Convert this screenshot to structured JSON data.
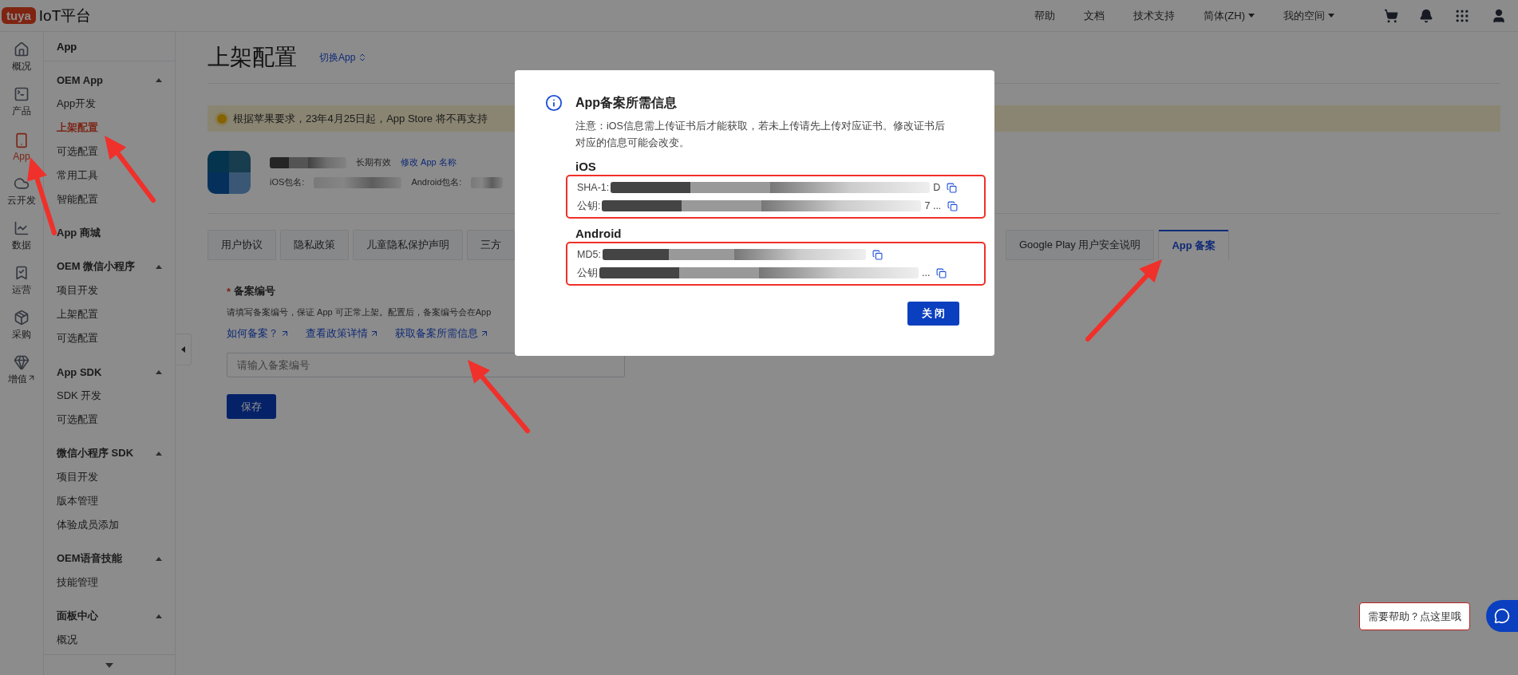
{
  "header": {
    "logo": "tuya",
    "title": "IoT平台",
    "links": [
      {
        "label": "帮助",
        "dropdown": false
      },
      {
        "label": "文档",
        "dropdown": false
      },
      {
        "label": "技术支持",
        "dropdown": false
      },
      {
        "label": "简体(ZH)",
        "dropdown": true
      },
      {
        "label": "我的空间",
        "dropdown": true
      }
    ]
  },
  "rail": [
    {
      "label": "概况",
      "selected": false,
      "external": false
    },
    {
      "label": "产品",
      "selected": false,
      "external": false
    },
    {
      "label": "App",
      "selected": true,
      "external": false
    },
    {
      "label": "云开发",
      "selected": false,
      "external": false
    },
    {
      "label": "数据",
      "selected": false,
      "external": false
    },
    {
      "label": "运营",
      "selected": false,
      "external": false
    },
    {
      "label": "采购",
      "selected": false,
      "external": false
    },
    {
      "label": "增值",
      "selected": false,
      "external": true
    }
  ],
  "sidebar": {
    "heading": "App",
    "groups": [
      {
        "kind": "group",
        "title": "OEM App",
        "expanded": true,
        "items": [
          {
            "label": "App开发",
            "selected": false
          },
          {
            "label": "上架配置",
            "selected": true
          },
          {
            "label": "可选配置",
            "selected": false
          },
          {
            "label": "常用工具",
            "selected": false
          },
          {
            "label": "智能配置",
            "selected": false
          }
        ]
      },
      {
        "kind": "link",
        "title": "App 商城"
      },
      {
        "kind": "group",
        "title": "OEM 微信小程序",
        "expanded": true,
        "items": [
          {
            "label": "项目开发",
            "selected": false
          },
          {
            "label": "上架配置",
            "selected": false
          },
          {
            "label": "可选配置",
            "selected": false
          }
        ]
      },
      {
        "kind": "group",
        "title": "App SDK",
        "expanded": true,
        "items": [
          {
            "label": "SDK 开发",
            "selected": false
          },
          {
            "label": "可选配置",
            "selected": false
          }
        ]
      },
      {
        "kind": "group",
        "title": "微信小程序 SDK",
        "expanded": true,
        "items": [
          {
            "label": "项目开发",
            "selected": false
          },
          {
            "label": "版本管理",
            "selected": false
          },
          {
            "label": "体验成员添加",
            "selected": false
          }
        ]
      },
      {
        "kind": "group",
        "title": "OEM语音技能",
        "expanded": true,
        "items": [
          {
            "label": "技能管理",
            "selected": false
          }
        ]
      },
      {
        "kind": "group",
        "title": "面板中心",
        "expanded": true,
        "items": [
          {
            "label": "概况",
            "selected": false
          }
        ]
      }
    ]
  },
  "page": {
    "title": "上架配置",
    "switch_link": "切换App",
    "notice": "根据苹果要求，23年4月25日起，App Store 将不再支持",
    "app": {
      "validity": "长期有效",
      "rename_link": "修改 App 名称",
      "ios_label": "iOS包名:",
      "android_label": "Android包名:"
    },
    "tabs": [
      {
        "label": "用户协议",
        "selected": false
      },
      {
        "label": "隐私政策",
        "selected": false
      },
      {
        "label": "儿童隐私保护声明",
        "selected": false
      },
      {
        "label": "三方",
        "selected": false
      },
      {
        "label": "Google Play 用户安全说明",
        "selected": false
      },
      {
        "label": "App 备案",
        "selected": true
      }
    ],
    "form": {
      "label": "备案编号",
      "required_mark": "*",
      "description": "请填写备案编号，保证 App 可正常上架。配置后，备案编号会在App",
      "links": [
        "如何备案？",
        "查看政策详情",
        "获取备案所需信息"
      ],
      "placeholder": "请输入备案编号",
      "save": "保存"
    }
  },
  "modal": {
    "title": "App备案所需信息",
    "note": "注意：iOS信息需上传证书后才能获取，若未上传请先上传对应证书。修改证书后对应的信息可能会改变。",
    "sections": [
      {
        "name": "iOS",
        "rows": [
          {
            "label": "SHA-1:",
            "tail": "D"
          },
          {
            "label": "公钥:",
            "tail": "7 ..."
          }
        ]
      },
      {
        "name": "Android",
        "rows": [
          {
            "label": "MD5:",
            "tail": ""
          },
          {
            "label": "公钥",
            "tail": "..."
          }
        ]
      }
    ],
    "close": "关 闭"
  },
  "help": {
    "label": "需要帮助？点这里哦"
  }
}
